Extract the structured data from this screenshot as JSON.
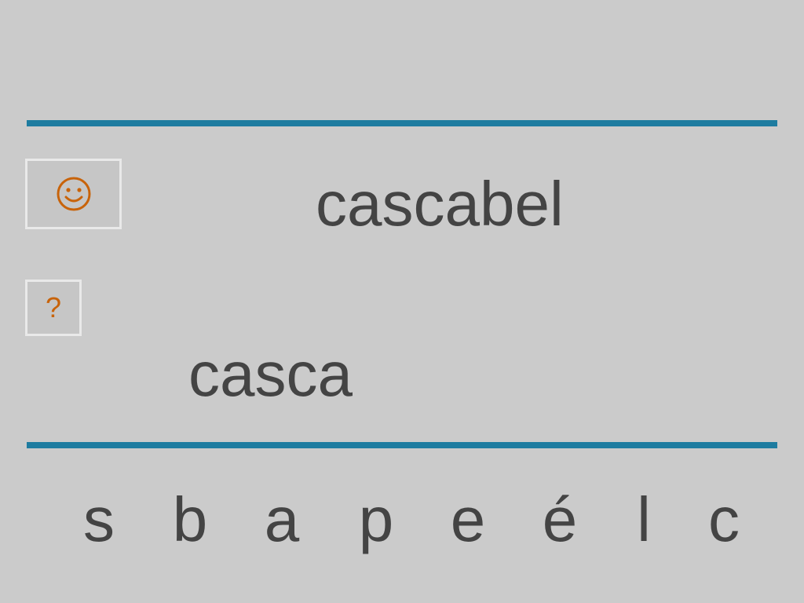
{
  "target_word": "cascabel",
  "answer": "casca",
  "hint_button": {
    "label": "?",
    "icon": "question-mark-icon"
  },
  "feedback_button": {
    "icon": "smiley-icon"
  },
  "letters": [
    "s",
    "b",
    "a",
    "p",
    "e",
    "é",
    "l",
    "c"
  ],
  "colors": {
    "background": "#cbcbcb",
    "rule": "#1e7ca0",
    "text": "#444444",
    "icon": "#c8630a",
    "button_border": "#e9e9e9"
  }
}
